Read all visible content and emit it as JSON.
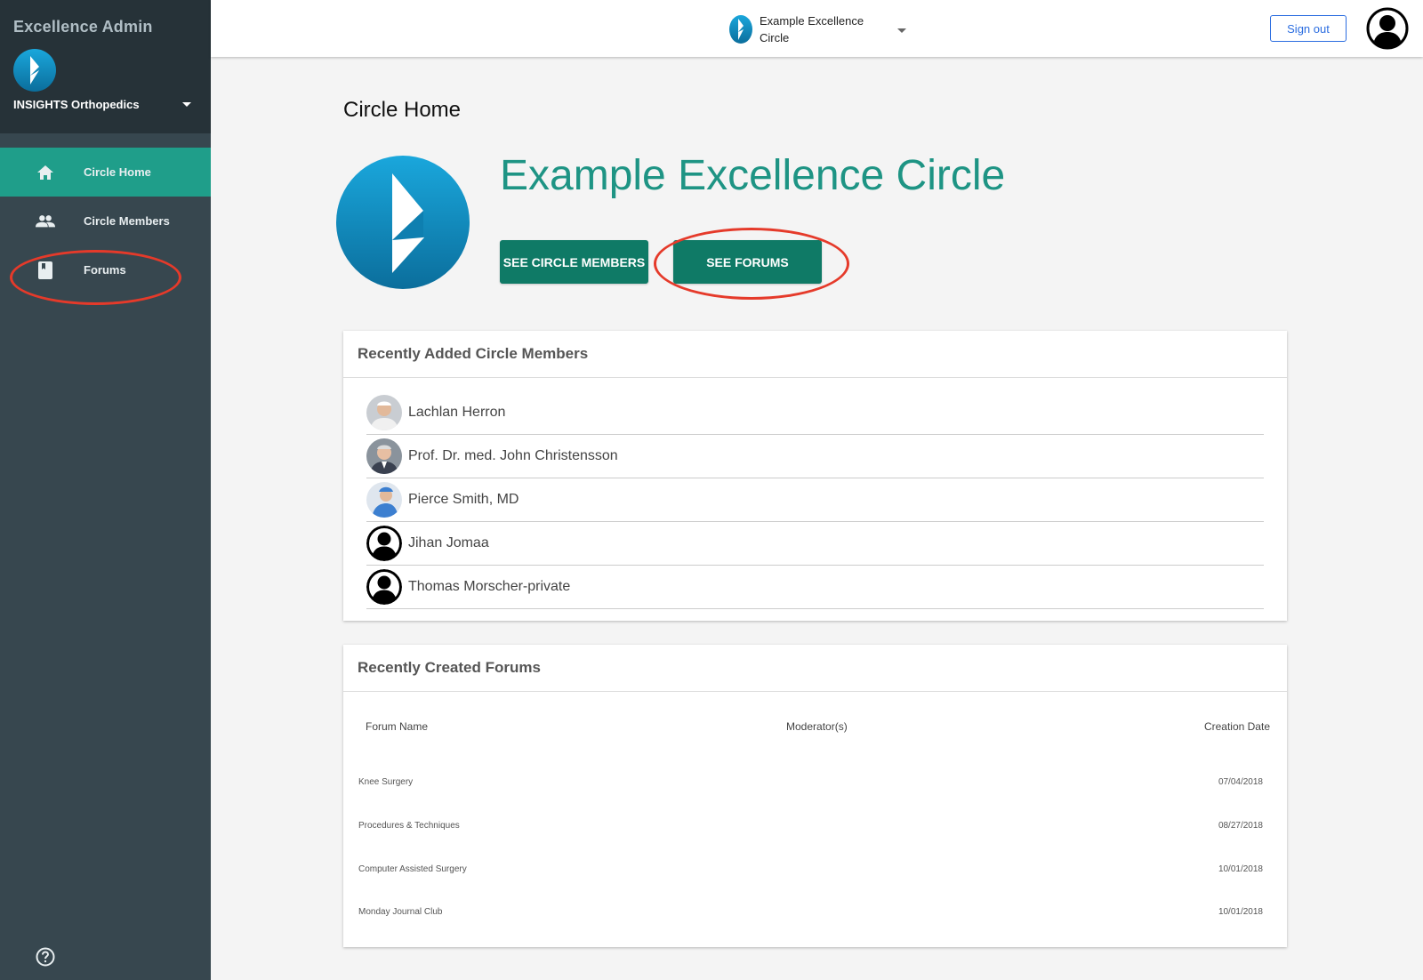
{
  "sidebar": {
    "app_title": "Excellence Admin",
    "org_name": "INSIGHTS Orthopedics",
    "items": [
      {
        "label": "Circle Home",
        "icon": "home-icon",
        "active": true
      },
      {
        "label": "Circle Members",
        "icon": "people-icon",
        "active": false
      },
      {
        "label": "Forums",
        "icon": "book-icon",
        "active": false
      }
    ],
    "help_icon": "help-circle-icon"
  },
  "topbar": {
    "circle_name": "Example Excellence Circle",
    "sign_out_label": "Sign out",
    "avatar_icon": "account-circle-icon"
  },
  "main": {
    "page_title": "Circle Home",
    "circle_title": "Example Excellence Circle",
    "see_members_label": "SEE CIRCLE MEMBERS",
    "see_forums_label": "SEE FORUMS"
  },
  "members_card": {
    "title": "Recently Added Circle Members",
    "members": [
      {
        "name": "Lachlan Herron",
        "avatar": "photo"
      },
      {
        "name": "Prof. Dr. med. John Christensson",
        "avatar": "photo"
      },
      {
        "name": "Pierce Smith, MD",
        "avatar": "photo"
      },
      {
        "name": "Jihan Jomaa",
        "avatar": "default"
      },
      {
        "name": "Thomas Morscher-private",
        "avatar": "default"
      }
    ]
  },
  "forums_card": {
    "title": "Recently Created Forums",
    "columns": [
      "Forum Name",
      "Moderator(s)",
      "Creation Date"
    ],
    "rows": [
      {
        "name": "Knee Surgery",
        "moderators": "",
        "date": "07/04/2018"
      },
      {
        "name": "Procedures & Techniques",
        "moderators": "",
        "date": "08/27/2018"
      },
      {
        "name": "Computer Assisted Surgery",
        "moderators": "",
        "date": "10/01/2018"
      },
      {
        "name": "Monday Journal Club",
        "moderators": "",
        "date": "10/01/2018"
      }
    ]
  },
  "colors": {
    "sidebar_bg": "#37474f",
    "sidebar_head_bg": "#263238",
    "active_nav": "#1f9e8a",
    "brand_teal": "#1e9484",
    "button": "#0f7a66",
    "annotation": "#e53a2a"
  }
}
